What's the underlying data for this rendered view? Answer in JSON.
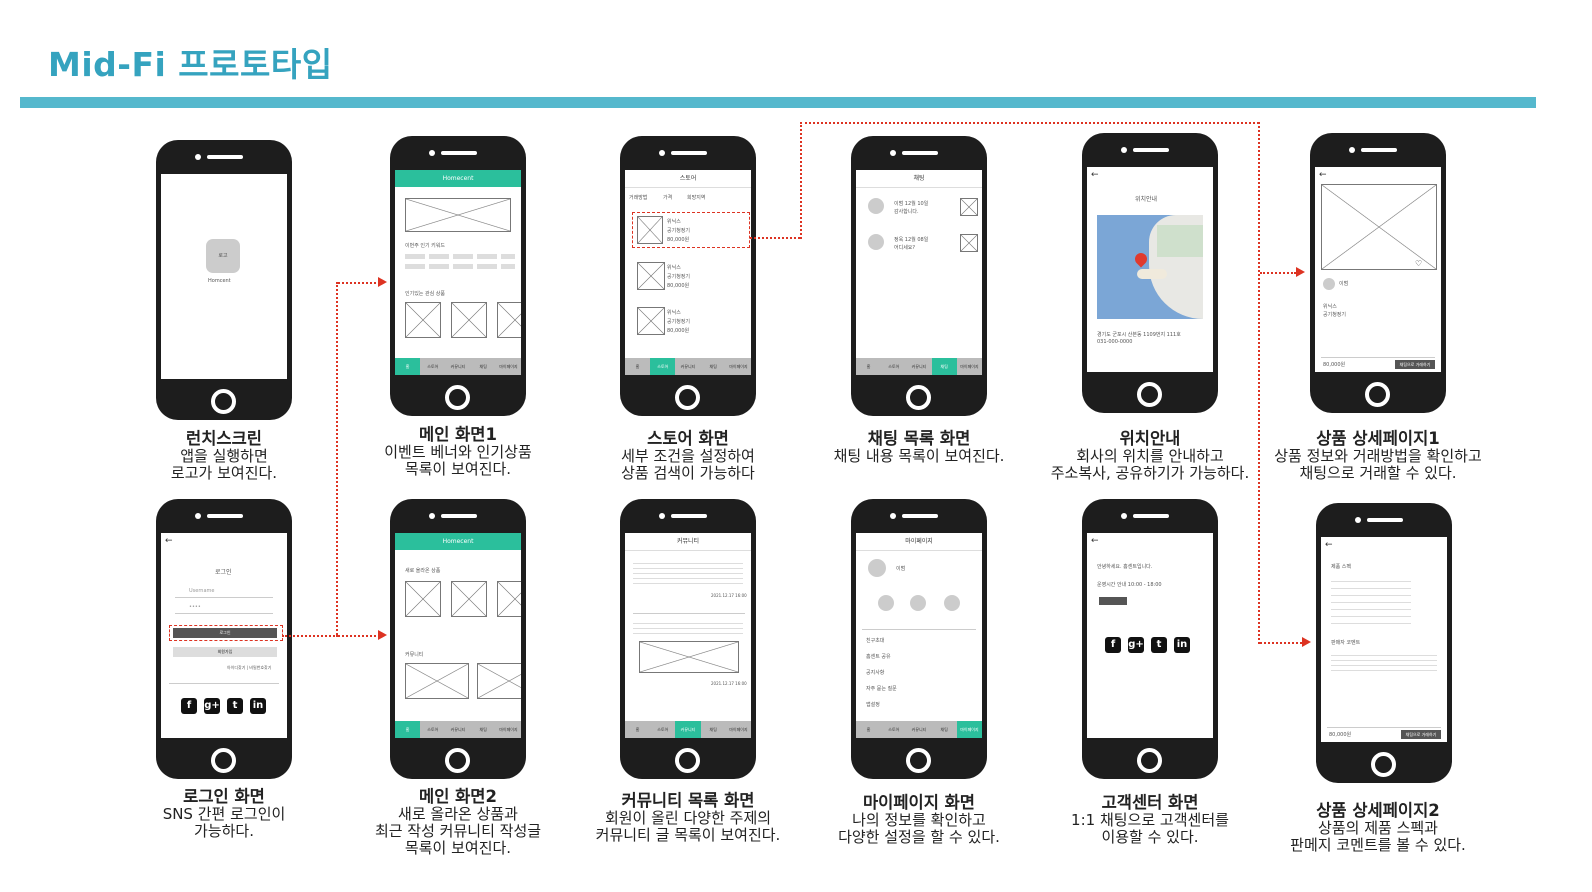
{
  "page": {
    "title": "Mid-Fi 프로토타입",
    "accent_color": "#55b8cd",
    "app_color": "#2bbf9c",
    "arrow_color": "#dd3322"
  },
  "screens": {
    "launch": {
      "app_name": "Homcent",
      "logo_text": "로고",
      "caption_title": "런치스크린",
      "caption_desc": "앱을 실행하면\n로고가 보여진다."
    },
    "main1": {
      "app_title": "Homecent",
      "section_keywords": "이번주 인기 키워드",
      "section_popular": "인기있는 관심 상품",
      "nav": [
        "홈",
        "스토어",
        "커뮤니티",
        "채팅",
        "마이페이지"
      ],
      "caption_title": "메인 화면1",
      "caption_desc": "이벤트 베너와 인기상품\n목록이 보여진다."
    },
    "store": {
      "header": "스토어",
      "filters": [
        "거래방법",
        "가격",
        "희망지역"
      ],
      "items": [
        {
          "name": "위닉스",
          "product": "공기청정기",
          "price": "80,000원"
        },
        {
          "name": "위닉스",
          "product": "공기청정기",
          "price": "80,000원"
        },
        {
          "name": "위닉스",
          "product": "공기청정기",
          "price": "80,000원"
        }
      ],
      "caption_title": "스토어 화면",
      "caption_desc": "세부 조건을 설정하여\n상품 검색이 가능하다"
    },
    "chat_list": {
      "header": "채팅",
      "chats": [
        {
          "line1": "이범 12월 10일",
          "line2": "감사합니다."
        },
        {
          "line1": "정욱 12월 08일",
          "line2": "어디세요?"
        }
      ],
      "caption_title": "채팅 목록 화면",
      "caption_desc": "채팅 내용 목록이 보여진다."
    },
    "location": {
      "header": "위치안내",
      "address": "경기도 군포시 산본동 1109번지 111호",
      "phone": "031-000-0000",
      "caption_title": "위치안내",
      "caption_desc": "회사의 위치를 안내하고\n주소복사, 공유하기가 가능하다."
    },
    "detail1": {
      "seller": "이범",
      "brand": "위닉스",
      "product": "공기청정기",
      "price": "80,000원",
      "chat_button": "채팅으로 거래하기",
      "caption_title": "상품 상세페이지1",
      "caption_desc": "상품 정보와 거래방법을 확인하고\n채팅으로 거래할 수 있다."
    },
    "login": {
      "header": "로그인",
      "username_placeholder": "Username",
      "password_placeholder": "••••",
      "login_button": "로그인",
      "signup_button": "회원가입",
      "find_links": "아이디찾기 | 비밀번호찾기",
      "social": [
        "f",
        "g+",
        "t",
        "in"
      ],
      "caption_title": "로그인 화면",
      "caption_desc": "SNS 간편 로그인이\n가능하다."
    },
    "main2": {
      "app_title": "Homecent",
      "section_new": "새로 올라온 상품",
      "section_community": "커뮤니티",
      "caption_title": "메인 화면2",
      "caption_desc": "새로 올라온 상품과\n최근 작성 커뮤니티 작성글\n목록이 보여진다."
    },
    "community": {
      "header": "커뮤니티",
      "post1_date": "2021.12.17 16:00",
      "post2_date": "2021.12.17 16:00",
      "caption_title": "커뮤니티 목록 화면",
      "caption_desc": "회원이 올린 다양한 주제의\n커뮤니티 글 목록이 보여진다."
    },
    "mypage": {
      "header": "마이페이지",
      "user": "이범",
      "menu": [
        "친구초대",
        "홈센트 공유",
        "공지사항",
        "자주 묻는 질문",
        "앱설정"
      ],
      "caption_title": "마이페이지 화면",
      "caption_desc": "나의 정보를 확인하고\n다양한 설정을 할 수 있다."
    },
    "support": {
      "greeting": "안녕하세요. 홈센트입니다.",
      "hours": "운영시간 안내  10:00 - 18:00",
      "caption_title": "고객센터 화면",
      "caption_desc": "1:1 채팅으로 고객센터를\n이용할 수 있다."
    },
    "detail2": {
      "spec_title": "제품 스펙",
      "seller_comment": "판매자 코멘트",
      "price": "80,000원",
      "chat_button": "채팅으로 거래하기",
      "caption_title": "상품 상세페이지2",
      "caption_desc": "상품의 제품 스펙과\n판메지 코멘트를 볼 수 있다."
    }
  }
}
